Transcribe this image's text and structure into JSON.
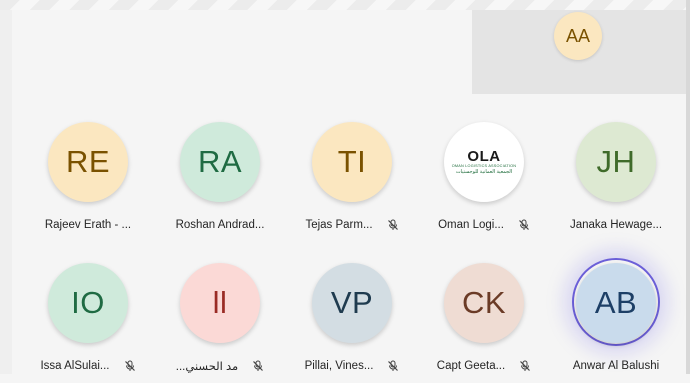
{
  "self_view": {
    "initials": "AA",
    "bg": "#fbe7c0",
    "fg": "#7a5200"
  },
  "participants": [
    {
      "initials": "RE",
      "name": "Rajeev Erath - ...",
      "muted": false,
      "bg": "#fbe7c0",
      "fg": "#7a5200"
    },
    {
      "initials": "RA",
      "name": "Roshan Andrad...",
      "muted": false,
      "bg": "#cfeadb",
      "fg": "#1f6b43"
    },
    {
      "initials": "TI",
      "name": "Tejas Parm...",
      "muted": true,
      "bg": "#fbe7c0",
      "fg": "#7a5200"
    },
    {
      "initials": "",
      "name": "Oman Logi...",
      "muted": true,
      "logo": {
        "title": "OLA",
        "subtitle": "OMAN LOGISTICS ASSOCIATION",
        "arabic": "الجمعية العمانية للوجستيات"
      }
    },
    {
      "initials": "JH",
      "name": "Janaka Hewage...",
      "muted": false,
      "bg": "#dde9d2",
      "fg": "#3f6b2a"
    },
    {
      "initials": "IO",
      "name": "Issa AlSulai...",
      "muted": true,
      "bg": "#cfeadb",
      "fg": "#1f6b43"
    },
    {
      "initials": "ll",
      "name": "...مد الحسني",
      "muted": true,
      "bg": "#fbd9d6",
      "fg": "#9a2b25"
    },
    {
      "initials": "VP",
      "name": "Pillai, Vines...",
      "muted": true,
      "bg": "#d3dde3",
      "fg": "#1f3b4f"
    },
    {
      "initials": "CK",
      "name": "Capt Geeta...",
      "muted": true,
      "bg": "#efdcd3",
      "fg": "#6b3b26"
    },
    {
      "initials": "AB",
      "name": "Anwar Al Balushi",
      "muted": false,
      "speaking": true,
      "bg": "#c9dbec",
      "fg": "#1d3f66"
    }
  ]
}
